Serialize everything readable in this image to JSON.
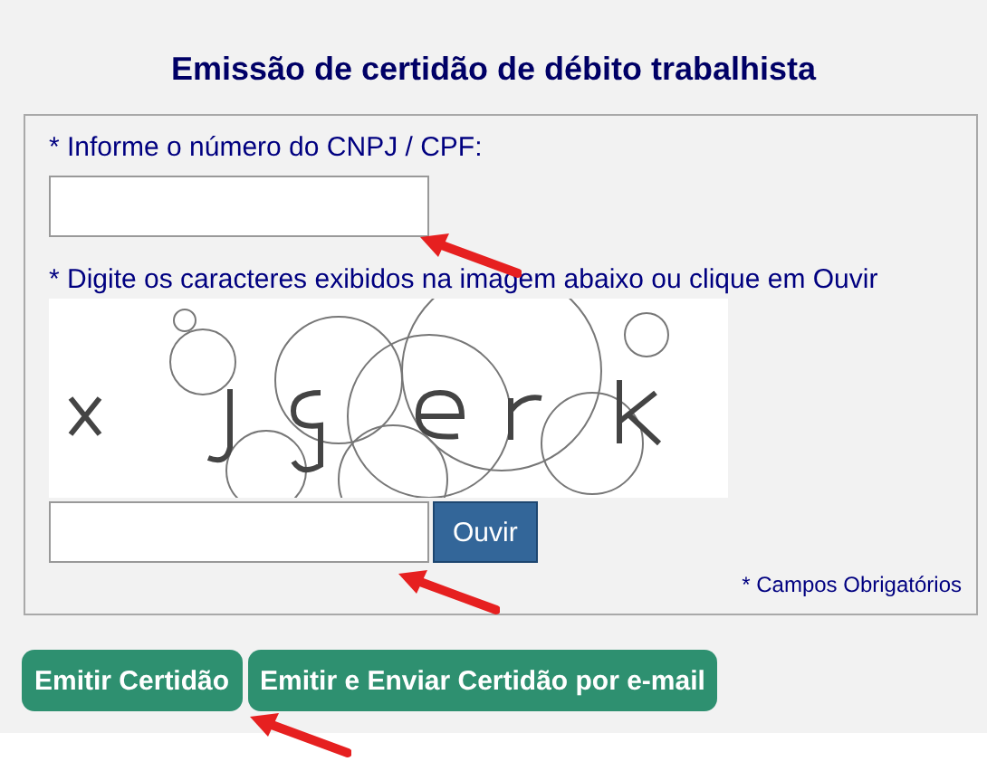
{
  "title": "Emissão de certidão de débito trabalhista",
  "form": {
    "cnpj_label": "* Informe o número do CNPJ / CPF:",
    "captcha_label": "* Digite os caracteres exibidos na imagem abaixo ou clique em Ouvir",
    "listen_button": "Ouvir",
    "required_note": "* Campos Obrigatórios"
  },
  "buttons": [
    "Emitir Certidão",
    "Emitir e Enviar Certidão por e-mail"
  ]
}
